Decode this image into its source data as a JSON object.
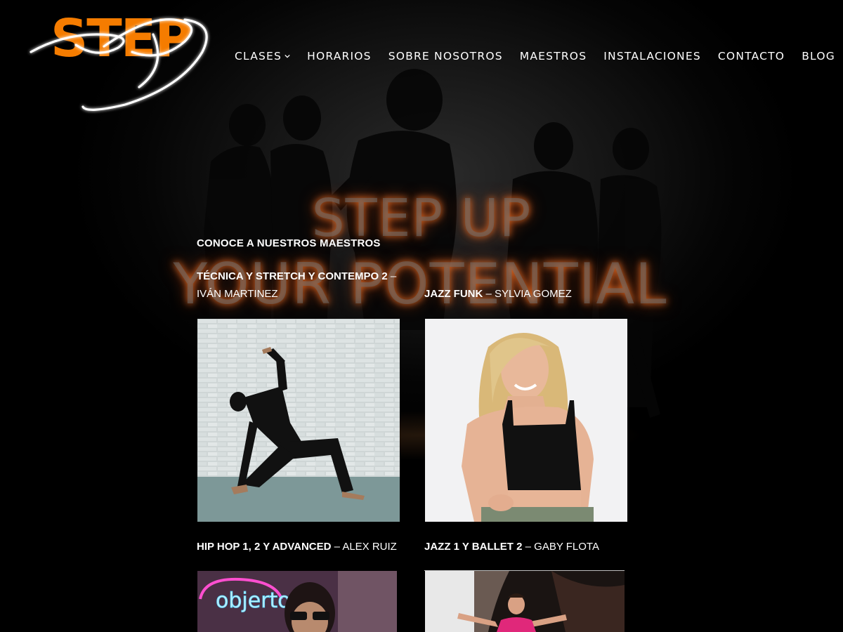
{
  "brand": {
    "logo_text": "STEP",
    "accent_color": "#f57c00"
  },
  "nav": {
    "items": [
      {
        "label": "CLASES",
        "has_dropdown": true,
        "icon": "chevron-down-icon"
      },
      {
        "label": "HORARIOS"
      },
      {
        "label": "SOBRE NOSOTROS"
      },
      {
        "label": "MAESTROS"
      },
      {
        "label": "INSTALACIONES"
      },
      {
        "label": "CONTACTO"
      },
      {
        "label": "BLOG"
      }
    ]
  },
  "hero": {
    "line1": "STEP UP",
    "line2": "YOUR POTENTIAL"
  },
  "teachers": {
    "section_title": "CONOCE A NUESTROS MAESTROS",
    "cards": [
      {
        "classes": "TÉCNICA Y STRETCH Y CONTEMPO 2",
        "sep": " –",
        "name": "IVÁN MARTINEZ",
        "photo": "dancer-pose-photo"
      },
      {
        "classes": "JAZZ FUNK",
        "sep": " – ",
        "name": "SYLVIA GOMEZ",
        "photo": "portrait-photo"
      },
      {
        "classes": "HIP HOP 1, 2 Y ADVANCED",
        "sep": " – ",
        "name": "ALEX RUIZ",
        "photo": "neon-portrait-photo"
      },
      {
        "classes": "JAZZ 1 Y BALLET 2",
        "sep": " – ",
        "name": "GABY FLOTA",
        "photo": "stage-dancer-photo"
      }
    ]
  }
}
